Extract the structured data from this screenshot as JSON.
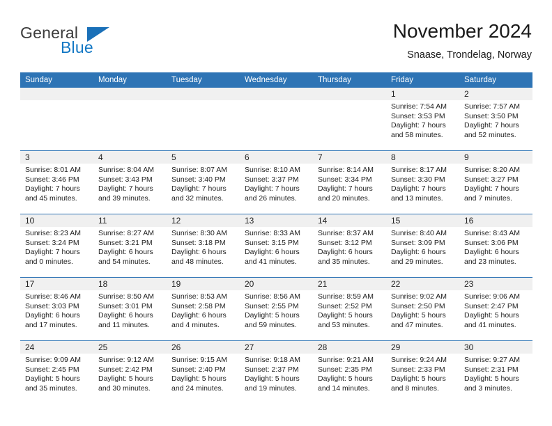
{
  "logo": {
    "word_top": "General",
    "word_bottom": "Blue",
    "triangle_color": "#1a70b8",
    "text_color": "#3b3b3b",
    "blue_color": "#1277c4"
  },
  "header": {
    "title": "November 2024",
    "subtitle": "Snaase, Trondelag, Norway"
  },
  "theme": {
    "header_blue": "#2e74b5",
    "daynum_bg": "#f0f0f0",
    "text": "#222222"
  },
  "weekdays": [
    "Sunday",
    "Monday",
    "Tuesday",
    "Wednesday",
    "Thursday",
    "Friday",
    "Saturday"
  ],
  "weeks": [
    [
      {
        "day": ""
      },
      {
        "day": ""
      },
      {
        "day": ""
      },
      {
        "day": ""
      },
      {
        "day": ""
      },
      {
        "day": "1",
        "sunrise": "Sunrise: 7:54 AM",
        "sunset": "Sunset: 3:53 PM",
        "daylight1": "Daylight: 7 hours",
        "daylight2": "and 58 minutes."
      },
      {
        "day": "2",
        "sunrise": "Sunrise: 7:57 AM",
        "sunset": "Sunset: 3:50 PM",
        "daylight1": "Daylight: 7 hours",
        "daylight2": "and 52 minutes."
      }
    ],
    [
      {
        "day": "3",
        "sunrise": "Sunrise: 8:01 AM",
        "sunset": "Sunset: 3:46 PM",
        "daylight1": "Daylight: 7 hours",
        "daylight2": "and 45 minutes."
      },
      {
        "day": "4",
        "sunrise": "Sunrise: 8:04 AM",
        "sunset": "Sunset: 3:43 PM",
        "daylight1": "Daylight: 7 hours",
        "daylight2": "and 39 minutes."
      },
      {
        "day": "5",
        "sunrise": "Sunrise: 8:07 AM",
        "sunset": "Sunset: 3:40 PM",
        "daylight1": "Daylight: 7 hours",
        "daylight2": "and 32 minutes."
      },
      {
        "day": "6",
        "sunrise": "Sunrise: 8:10 AM",
        "sunset": "Sunset: 3:37 PM",
        "daylight1": "Daylight: 7 hours",
        "daylight2": "and 26 minutes."
      },
      {
        "day": "7",
        "sunrise": "Sunrise: 8:14 AM",
        "sunset": "Sunset: 3:34 PM",
        "daylight1": "Daylight: 7 hours",
        "daylight2": "and 20 minutes."
      },
      {
        "day": "8",
        "sunrise": "Sunrise: 8:17 AM",
        "sunset": "Sunset: 3:30 PM",
        "daylight1": "Daylight: 7 hours",
        "daylight2": "and 13 minutes."
      },
      {
        "day": "9",
        "sunrise": "Sunrise: 8:20 AM",
        "sunset": "Sunset: 3:27 PM",
        "daylight1": "Daylight: 7 hours",
        "daylight2": "and 7 minutes."
      }
    ],
    [
      {
        "day": "10",
        "sunrise": "Sunrise: 8:23 AM",
        "sunset": "Sunset: 3:24 PM",
        "daylight1": "Daylight: 7 hours",
        "daylight2": "and 0 minutes."
      },
      {
        "day": "11",
        "sunrise": "Sunrise: 8:27 AM",
        "sunset": "Sunset: 3:21 PM",
        "daylight1": "Daylight: 6 hours",
        "daylight2": "and 54 minutes."
      },
      {
        "day": "12",
        "sunrise": "Sunrise: 8:30 AM",
        "sunset": "Sunset: 3:18 PM",
        "daylight1": "Daylight: 6 hours",
        "daylight2": "and 48 minutes."
      },
      {
        "day": "13",
        "sunrise": "Sunrise: 8:33 AM",
        "sunset": "Sunset: 3:15 PM",
        "daylight1": "Daylight: 6 hours",
        "daylight2": "and 41 minutes."
      },
      {
        "day": "14",
        "sunrise": "Sunrise: 8:37 AM",
        "sunset": "Sunset: 3:12 PM",
        "daylight1": "Daylight: 6 hours",
        "daylight2": "and 35 minutes."
      },
      {
        "day": "15",
        "sunrise": "Sunrise: 8:40 AM",
        "sunset": "Sunset: 3:09 PM",
        "daylight1": "Daylight: 6 hours",
        "daylight2": "and 29 minutes."
      },
      {
        "day": "16",
        "sunrise": "Sunrise: 8:43 AM",
        "sunset": "Sunset: 3:06 PM",
        "daylight1": "Daylight: 6 hours",
        "daylight2": "and 23 minutes."
      }
    ],
    [
      {
        "day": "17",
        "sunrise": "Sunrise: 8:46 AM",
        "sunset": "Sunset: 3:03 PM",
        "daylight1": "Daylight: 6 hours",
        "daylight2": "and 17 minutes."
      },
      {
        "day": "18",
        "sunrise": "Sunrise: 8:50 AM",
        "sunset": "Sunset: 3:01 PM",
        "daylight1": "Daylight: 6 hours",
        "daylight2": "and 11 minutes."
      },
      {
        "day": "19",
        "sunrise": "Sunrise: 8:53 AM",
        "sunset": "Sunset: 2:58 PM",
        "daylight1": "Daylight: 6 hours",
        "daylight2": "and 4 minutes."
      },
      {
        "day": "20",
        "sunrise": "Sunrise: 8:56 AM",
        "sunset": "Sunset: 2:55 PM",
        "daylight1": "Daylight: 5 hours",
        "daylight2": "and 59 minutes."
      },
      {
        "day": "21",
        "sunrise": "Sunrise: 8:59 AM",
        "sunset": "Sunset: 2:52 PM",
        "daylight1": "Daylight: 5 hours",
        "daylight2": "and 53 minutes."
      },
      {
        "day": "22",
        "sunrise": "Sunrise: 9:02 AM",
        "sunset": "Sunset: 2:50 PM",
        "daylight1": "Daylight: 5 hours",
        "daylight2": "and 47 minutes."
      },
      {
        "day": "23",
        "sunrise": "Sunrise: 9:06 AM",
        "sunset": "Sunset: 2:47 PM",
        "daylight1": "Daylight: 5 hours",
        "daylight2": "and 41 minutes."
      }
    ],
    [
      {
        "day": "24",
        "sunrise": "Sunrise: 9:09 AM",
        "sunset": "Sunset: 2:45 PM",
        "daylight1": "Daylight: 5 hours",
        "daylight2": "and 35 minutes."
      },
      {
        "day": "25",
        "sunrise": "Sunrise: 9:12 AM",
        "sunset": "Sunset: 2:42 PM",
        "daylight1": "Daylight: 5 hours",
        "daylight2": "and 30 minutes."
      },
      {
        "day": "26",
        "sunrise": "Sunrise: 9:15 AM",
        "sunset": "Sunset: 2:40 PM",
        "daylight1": "Daylight: 5 hours",
        "daylight2": "and 24 minutes."
      },
      {
        "day": "27",
        "sunrise": "Sunrise: 9:18 AM",
        "sunset": "Sunset: 2:37 PM",
        "daylight1": "Daylight: 5 hours",
        "daylight2": "and 19 minutes."
      },
      {
        "day": "28",
        "sunrise": "Sunrise: 9:21 AM",
        "sunset": "Sunset: 2:35 PM",
        "daylight1": "Daylight: 5 hours",
        "daylight2": "and 14 minutes."
      },
      {
        "day": "29",
        "sunrise": "Sunrise: 9:24 AM",
        "sunset": "Sunset: 2:33 PM",
        "daylight1": "Daylight: 5 hours",
        "daylight2": "and 8 minutes."
      },
      {
        "day": "30",
        "sunrise": "Sunrise: 9:27 AM",
        "sunset": "Sunset: 2:31 PM",
        "daylight1": "Daylight: 5 hours",
        "daylight2": "and 3 minutes."
      }
    ]
  ]
}
